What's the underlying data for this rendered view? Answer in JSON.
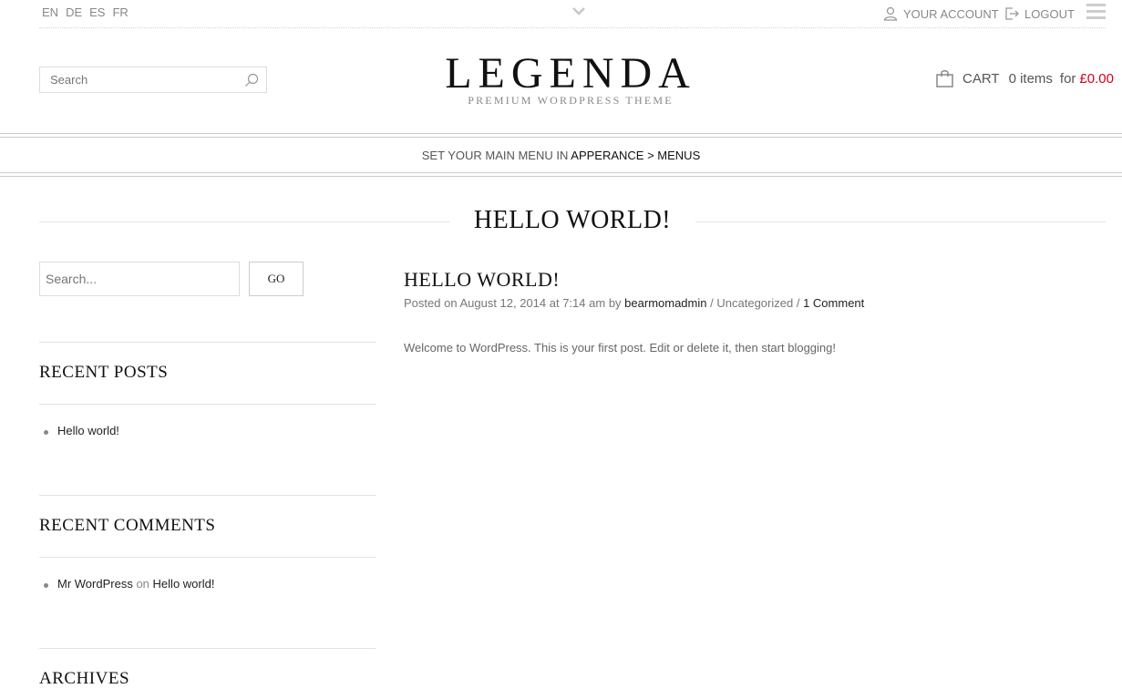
{
  "topbar": {
    "languages": [
      "EN",
      "DE",
      "ES",
      "FR"
    ],
    "account_label": "YOUR ACCOUNT",
    "logout_label": "LOGOUT"
  },
  "header": {
    "search_placeholder": "Search",
    "logo_title": "LEGENDA",
    "logo_subtitle": "PREMIUM WORDPRESS THEME",
    "cart": {
      "label": "CART",
      "count": "0 items",
      "for": "for",
      "price": "£0.00",
      "price_color": "#d0021b"
    }
  },
  "menu": {
    "prefix": "SET YOUR MAIN MENU IN",
    "path": "APPERANCE > MENUS"
  },
  "page_title": "HELLO WORLD!",
  "sidebar": {
    "search_placeholder": "Search...",
    "go_label": "GO",
    "recent_posts": {
      "title": "RECENT POSTS",
      "items": [
        "Hello world!"
      ]
    },
    "recent_comments": {
      "title": "RECENT COMMENTS",
      "items": [
        {
          "author": "Mr WordPress",
          "on": "on",
          "post": "Hello world!"
        }
      ]
    },
    "archives": {
      "title": "ARCHIVES"
    }
  },
  "post": {
    "title": "HELLO WORLD!",
    "posted_on": "Posted on",
    "date": "August 12, 2014 at 7:14 am",
    "by": "by",
    "author": "bearmomadmin",
    "sep": "/",
    "category": "Uncategorized",
    "comments": "1 Comment",
    "body": "Welcome to WordPress. This is your first post. Edit or delete it, then start blogging!"
  }
}
